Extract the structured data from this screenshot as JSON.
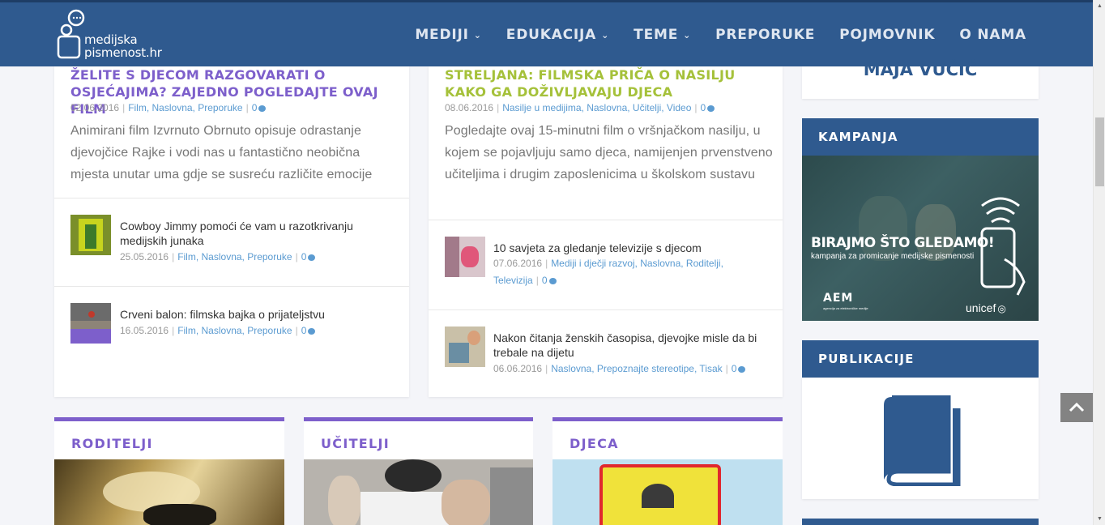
{
  "header": {
    "logo_line1": "medijska",
    "logo_line2": "pismenost.hr",
    "nav": [
      {
        "label": "MEDIJI",
        "has_dropdown": true
      },
      {
        "label": "EDUKACIJA",
        "has_dropdown": true
      },
      {
        "label": "TEME",
        "has_dropdown": true
      },
      {
        "label": "PREPORUKE",
        "has_dropdown": false
      },
      {
        "label": "POJMOVNIK",
        "has_dropdown": false
      },
      {
        "label": "O NAMA",
        "has_dropdown": false
      }
    ]
  },
  "left_card": {
    "title": "ŽELITE S DJECOM RAZGOVARATI O OSJEĆAJIMA? ZAJEDNO POGLEDAJTE OVAJ FILM",
    "date": "02.06.2016",
    "categories": "Film, Naslovna, Preporuke",
    "comments": "0",
    "excerpt": "Animirani film Izvrnuto Obrnuto opisuje odrastanje djevojčice Rajke i vodi nas u fantastično neobična mjesta unutar uma gdje se susreću različite emocije",
    "items": [
      {
        "title": "Cowboy Jimmy pomoći će vam u razotkrivanju medijskih junaka",
        "date": "25.05.2016",
        "categories": "Film, Naslovna, Preporuke",
        "comments": "0"
      },
      {
        "title": "Crveni balon: filmska bajka o prijateljstvu",
        "date": "16.05.2016",
        "categories": "Film, Naslovna, Preporuke",
        "comments": "0"
      }
    ]
  },
  "mid_card": {
    "title": "STRELJANA: FILMSKA PRIČA O NASILJU KAKO GA DOŽIVLJAVAJU DJECA",
    "date": "08.06.2016",
    "categories": "Nasilje u medijima, Naslovna, Učitelji, Video",
    "comments": "0",
    "excerpt": "Pogledajte ovaj 15-minutni film o vršnjačkom nasilju, u kojem se pojavljuju samo djeca, namijenjen prvenstveno učiteljima i drugim zaposlenicima u školskom sustavu",
    "items": [
      {
        "title": "10 savjeta za gledanje televizije s djecom",
        "date": "07.06.2016",
        "categories": "Mediji i dječji razvoj, Naslovna, Roditelji,",
        "categories2": "Televizija",
        "comments": "0"
      },
      {
        "title": "Nakon čitanja ženskih časopisa, djevojke misle da bi trebale na dijetu",
        "date": "06.06.2016",
        "categories": "Naslovna, Prepoznajte stereotipe, Tisak",
        "comments": "0"
      }
    ]
  },
  "sidebar": {
    "top_name": "MAJA VUČIĆ",
    "kampanja_title": "KAMPANJA",
    "banner_headline": "BIRAJMO ŠTO GLEDAMO!",
    "banner_sub": "kampanja za promicanje medijske pismenosti",
    "banner_logo_left": "AEM",
    "banner_logo_left_sub": "agencija za elektroničke medije",
    "banner_logo_right": "unicef",
    "publikacije_title": "PUBLIKACIJE"
  },
  "categories": [
    {
      "label": "RODITELJI"
    },
    {
      "label": "UČITELJI"
    },
    {
      "label": "DJECA"
    }
  ],
  "colors": {
    "header": "#2f5a8f",
    "purple": "#7d5fcb",
    "green": "#a5c13a",
    "link": "#5b9bd1"
  }
}
